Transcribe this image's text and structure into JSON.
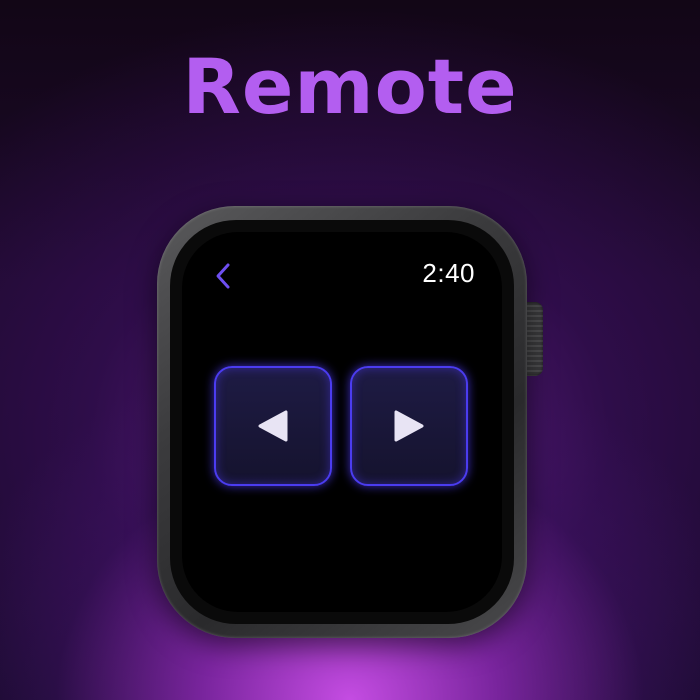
{
  "header": {
    "title": "Remote"
  },
  "watch": {
    "status_bar": {
      "back_icon": "chevron-left-icon",
      "time": "2:40"
    },
    "controls": [
      {
        "id": "previous",
        "icon": "play-left-triangle-icon"
      },
      {
        "id": "next",
        "icon": "play-right-triangle-icon"
      }
    ]
  },
  "colors": {
    "title": "#b35ef0",
    "accent": "#4b3cf0",
    "button_fill": "#1e1b44",
    "icon": "#e8e4f4",
    "back_icon": "#6e4ff0"
  }
}
